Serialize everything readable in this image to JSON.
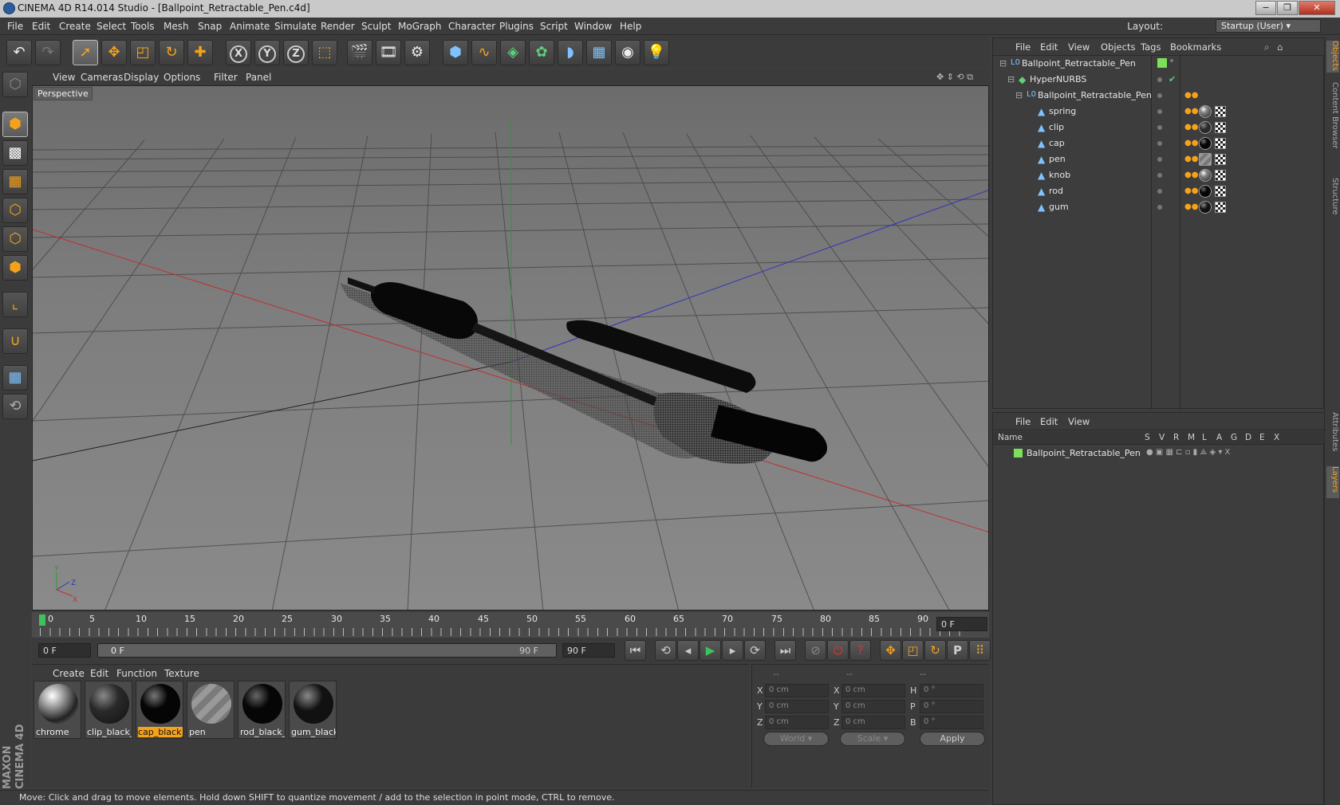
{
  "window": {
    "title": "CINEMA 4D R14.014 Studio - [Ballpoint_Retractable_Pen.c4d]",
    "minimize_glyph": "−",
    "restore_glyph": "❐",
    "close_glyph": "✕"
  },
  "menubar": {
    "items": [
      "File",
      "Edit",
      "Create",
      "Select",
      "Tools",
      "Mesh",
      "Snap",
      "Animate",
      "Simulate",
      "Render",
      "Sculpt",
      "MoGraph",
      "Character",
      "Plugins",
      "Script",
      "Window",
      "Help"
    ],
    "layout_label": "Layout:",
    "layout_value": "Startup (User)"
  },
  "toolbar": {
    "icons": [
      "undo-icon",
      "redo-icon",
      "live-selection-icon",
      "move-icon",
      "scale-icon",
      "rotate-icon",
      "add-icon",
      "x-axis-icon",
      "y-axis-icon",
      "z-axis-icon",
      "coordinate-system-icon",
      "render-view-icon",
      "render-picture-viewer-icon",
      "edit-render-settings-icon",
      "cube-icon",
      "spline-icon",
      "nurbs-icon",
      "array-icon",
      "deformer-icon",
      "floor-icon",
      "camera-icon",
      "light-icon"
    ],
    "axis_x": "X",
    "axis_y": "Y",
    "axis_z": "Z"
  },
  "left_tools": [
    "make-editable-icon",
    "model-mode-icon",
    "texture-mode-icon",
    "workplane-icon",
    "points-mode-icon",
    "edges-mode-icon",
    "polygons-mode-icon",
    "axis-mode-icon",
    "snapping-icon",
    "locked-workplane-icon",
    "planar-workplane-icon"
  ],
  "brand": "MAXON CINEMA 4D",
  "viewport": {
    "menu": [
      "View",
      "Cameras",
      "Display",
      "Options",
      "Filter",
      "Panel"
    ],
    "label": "Perspective",
    "axis_labels": {
      "y": "Y",
      "z": "Z",
      "x": "X"
    }
  },
  "timeline": {
    "ticks": [
      "0",
      "5",
      "10",
      "15",
      "20",
      "25",
      "30",
      "35",
      "40",
      "45",
      "50",
      "55",
      "60",
      "65",
      "70",
      "75",
      "80",
      "85",
      "90"
    ],
    "current_frame": "0 F",
    "start_field": "0 F",
    "range_start": "0 F",
    "range_end": "90 F",
    "end_field": "90 F"
  },
  "playback": {
    "buttons": [
      "go-to-start-icon",
      "previous-key-icon",
      "previous-frame-icon",
      "play-icon",
      "next-frame-icon",
      "next-key-icon",
      "go-to-end-icon",
      "record-icon",
      "autokey-icon",
      "keyframe-selection-icon",
      "position-key-icon",
      "scale-key-icon",
      "rotation-key-icon",
      "param-key-icon",
      "pla-key-icon",
      "timeline-icon"
    ],
    "param_key_label": "P"
  },
  "materials": {
    "menu": [
      "Create",
      "Edit",
      "Function",
      "Texture"
    ],
    "items": [
      {
        "name": "chrome",
        "color": "#9a9a9a",
        "highlight": false
      },
      {
        "name": "clip_black_",
        "color": "#2a2a2a",
        "highlight": false
      },
      {
        "name": "cap_black_",
        "color": "#050505",
        "highlight": true
      },
      {
        "name": "pen",
        "color": "#8c8c8c",
        "highlight": false
      },
      {
        "name": "rod_black_",
        "color": "#060606",
        "highlight": false
      },
      {
        "name": "gum_black",
        "color": "#111111",
        "highlight": false
      }
    ]
  },
  "coordinates": {
    "headers": [
      "--",
      "--",
      "--"
    ],
    "rows": [
      {
        "a_label": "X",
        "a_val": "0 cm",
        "b_label": "X",
        "b_val": "0 cm",
        "c_label": "H",
        "c_val": "0 °"
      },
      {
        "a_label": "Y",
        "a_val": "0 cm",
        "b_label": "Y",
        "b_val": "0 cm",
        "c_label": "P",
        "c_val": "0 °"
      },
      {
        "a_label": "Z",
        "a_val": "0 cm",
        "b_label": "Z",
        "b_val": "0 cm",
        "c_label": "B",
        "c_val": "0 °"
      }
    ],
    "world_label": "World",
    "scale_label": "Scale",
    "apply_label": "Apply"
  },
  "status": "Move: Click and drag to move elements. Hold down SHIFT to quantize movement / add to the selection in point mode, CTRL to remove.",
  "object_manager": {
    "menu": [
      "File",
      "Edit",
      "View",
      "Objects",
      "Tags",
      "Bookmarks"
    ],
    "objects": [
      {
        "name": "Ballpoint_Retractable_Pen",
        "icon": "null-icon",
        "depth": 0,
        "icon_glyph": "L0"
      },
      {
        "name": "HyperNURBS",
        "icon": "hypernurbs-icon",
        "depth": 1,
        "icon_glyph": "◆"
      },
      {
        "name": "Ballpoint_Retractable_Pen",
        "icon": "null-icon",
        "depth": 2,
        "icon_glyph": "L0"
      },
      {
        "name": "spring",
        "icon": "polygon-object-icon",
        "depth": 3,
        "icon_glyph": "▲"
      },
      {
        "name": "clip",
        "icon": "polygon-object-icon",
        "depth": 3,
        "icon_glyph": "▲"
      },
      {
        "name": "cap",
        "icon": "polygon-object-icon",
        "depth": 3,
        "icon_glyph": "▲"
      },
      {
        "name": "pen",
        "icon": "polygon-object-icon",
        "depth": 3,
        "icon_glyph": "▲"
      },
      {
        "name": "knob",
        "icon": "polygon-object-icon",
        "depth": 3,
        "icon_glyph": "▲"
      },
      {
        "name": "rod",
        "icon": "polygon-object-icon",
        "depth": 3,
        "icon_glyph": "▲"
      },
      {
        "name": "gum",
        "icon": "polygon-object-icon",
        "depth": 3,
        "icon_glyph": "▲"
      }
    ]
  },
  "layer_manager": {
    "menu": [
      "File",
      "Edit",
      "View"
    ],
    "columns": [
      "Name",
      "S",
      "V",
      "R",
      "M",
      "L",
      "A",
      "G",
      "D",
      "E",
      "X"
    ],
    "layers": [
      {
        "name": "Ballpoint_Retractable_Pen",
        "color": "#7ee05a"
      }
    ]
  },
  "right_tabs": [
    "Objects",
    "Content Browser",
    "Structure",
    "Attributes",
    "Layers"
  ],
  "colors": {
    "accent": "#f4a21c",
    "layer_green": "#7ee05a",
    "axis_x": "#c03030",
    "axis_y": "#2e9a2e",
    "axis_z": "#3030c0"
  }
}
